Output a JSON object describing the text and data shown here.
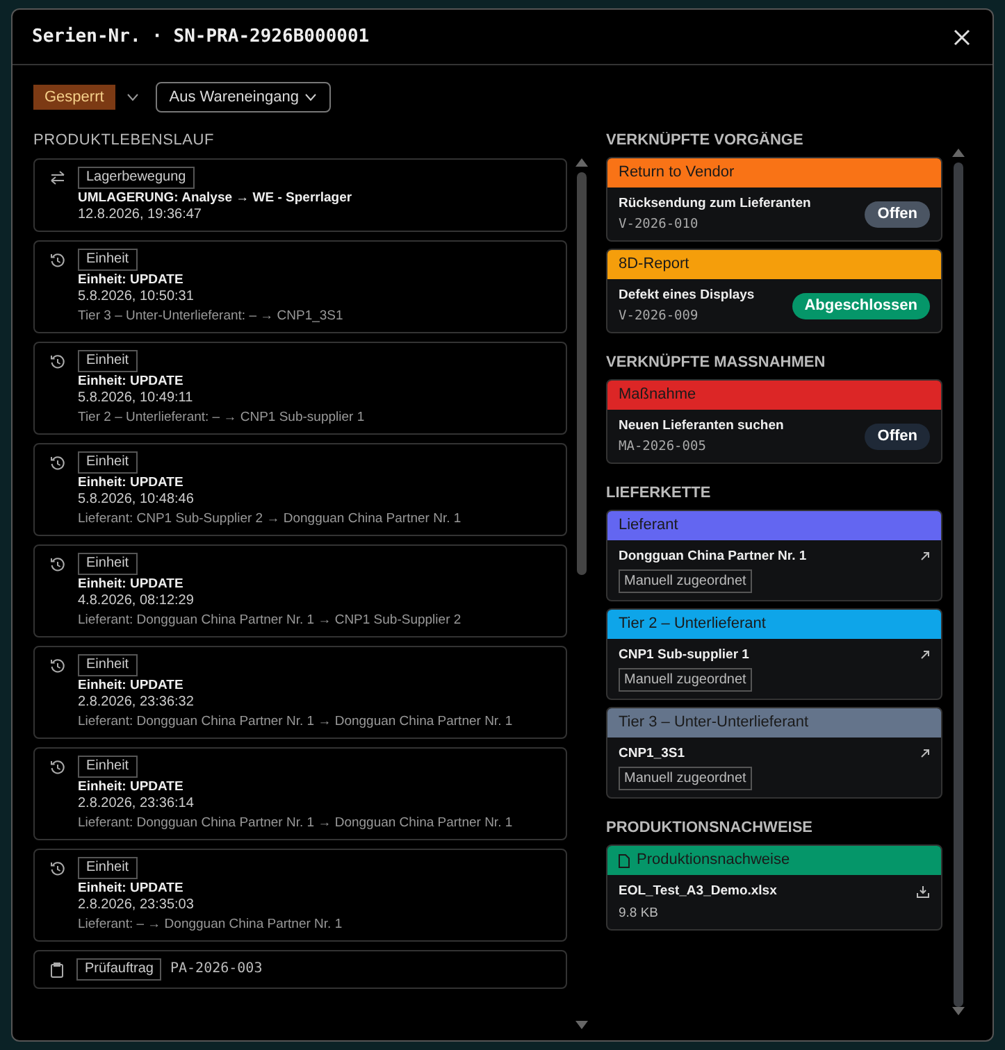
{
  "dialog": {
    "title": "Serien-Nr. · SN-PRA-2926B000001"
  },
  "toolbar": {
    "status": {
      "label": "Gesperrt",
      "color": "#7c3a14"
    },
    "origin": {
      "label": "Aus Wareneingang"
    }
  },
  "history": {
    "heading": "PRODUKTLEBENSLAUF",
    "entries": [
      {
        "kind": "movement",
        "tag": "Lagerbewegung",
        "title": "UMLAGERUNG: Analyse → WE - Sperrlager",
        "time": "12.8.2026, 19:36:47"
      },
      {
        "kind": "update",
        "tag": "Einheit",
        "title": "Einheit: UPDATE",
        "time": "5.8.2026, 10:50:31",
        "detail": "Tier 3 – Unter-Unterlieferant: – → CNP1_3S1"
      },
      {
        "kind": "update",
        "tag": "Einheit",
        "title": "Einheit: UPDATE",
        "time": "5.8.2026, 10:49:11",
        "detail": "Tier 2 – Unterlieferant: – → CNP1 Sub-supplier 1"
      },
      {
        "kind": "update",
        "tag": "Einheit",
        "title": "Einheit: UPDATE",
        "time": "5.8.2026, 10:48:46",
        "detail": "Lieferant: CNP1 Sub-Supplier 2 → Dongguan China Partner Nr. 1"
      },
      {
        "kind": "update",
        "tag": "Einheit",
        "title": "Einheit: UPDATE",
        "time": "4.8.2026, 08:12:29",
        "detail": "Lieferant: Dongguan China Partner Nr. 1 → CNP1 Sub-Supplier 2"
      },
      {
        "kind": "update",
        "tag": "Einheit",
        "title": "Einheit: UPDATE",
        "time": "2.8.2026, 23:36:32",
        "detail": "Lieferant: Dongguan China Partner Nr. 1 → Dongguan China Partner Nr. 1"
      },
      {
        "kind": "update",
        "tag": "Einheit",
        "title": "Einheit: UPDATE",
        "time": "2.8.2026, 23:36:14",
        "detail": "Lieferant: Dongguan China Partner Nr. 1 → Dongguan China Partner Nr. 1"
      },
      {
        "kind": "update",
        "tag": "Einheit",
        "title": "Einheit: UPDATE",
        "time": "2.8.2026, 23:35:03",
        "detail": "Lieferant: – → Dongguan China Partner Nr. 1"
      },
      {
        "kind": "inspection",
        "tag": "Prüfauftrag",
        "ref": "PA-2026-003"
      }
    ]
  },
  "processes": {
    "heading": "VERKNÜPFTE VORGÄNGE",
    "items": [
      {
        "type": "Return to Vendor",
        "color": "#f97316",
        "title": "Rücksendung zum Lieferanten",
        "ref": "V-2026-010",
        "status": {
          "label": "Offen",
          "color": "#4b5563"
        }
      },
      {
        "type": "8D-Report",
        "color": "#f59e0b",
        "title": "Defekt eines Displays",
        "ref": "V-2026-009",
        "status": {
          "label": "Abgeschlossen",
          "color": "#059669"
        }
      }
    ]
  },
  "measures": {
    "heading": "VERKNÜPFTE MASSNAHMEN",
    "items": [
      {
        "type": "Maßnahme",
        "color": "#dc2626",
        "title": "Neuen Lieferanten suchen",
        "ref": "MA-2026-005",
        "status": {
          "label": "Offen",
          "color": "#1f2937"
        }
      }
    ]
  },
  "supply_chain": {
    "heading": "LIEFERKETTE",
    "items": [
      {
        "tier": "Lieferant",
        "color": "#6366f1",
        "name": "Dongguan China Partner Nr. 1",
        "tag": "Manuell zugeordnet"
      },
      {
        "tier": "Tier 2 – Unterlieferant",
        "color": "#0ea5e9",
        "name": "CNP1 Sub-supplier 1",
        "tag": "Manuell zugeordnet"
      },
      {
        "tier": "Tier 3 – Unter-Unterlieferant",
        "color": "#64748b",
        "name": "CNP1_3S1",
        "tag": "Manuell zugeordnet"
      }
    ]
  },
  "evidence": {
    "heading": "PRODUKTIONSNACHWEISE",
    "items": [
      {
        "type": "Produktionsnachweise",
        "color": "#059669",
        "file": "EOL_Test_A3_Demo.xlsx",
        "size": "9.8 KB"
      }
    ]
  }
}
